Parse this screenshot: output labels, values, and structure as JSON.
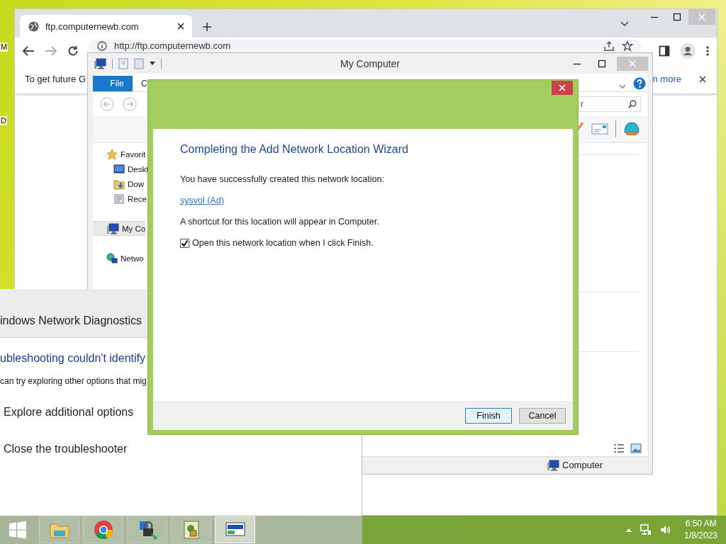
{
  "desktop": {
    "icon_labels": [
      "M",
      "D"
    ]
  },
  "browser": {
    "tab": {
      "title": "ftp.computernewb.com",
      "selected": true
    },
    "address": "http://ftp.computernewb.com",
    "infobar": {
      "message": "To get future G",
      "link": "n more"
    }
  },
  "explorer": {
    "title": "My Computer",
    "ribbon_tabs": [
      {
        "label": "File",
        "selected": true
      },
      {
        "label": "C",
        "selected": false
      }
    ],
    "search": {
      "placeholder": "r"
    },
    "nav_items": [
      {
        "label": "Favorit",
        "kind": "favorites",
        "selected": false,
        "children": [
          {
            "label": "Deskt",
            "kind": "desktop",
            "selected": false
          },
          {
            "label": "Dow",
            "kind": "downloads",
            "selected": false
          },
          {
            "label": "Rece",
            "kind": "recent",
            "selected": false
          }
        ]
      },
      {
        "label": "My Co",
        "kind": "computer",
        "selected": true
      },
      {
        "label": "Netwo",
        "kind": "network",
        "selected": false
      }
    ],
    "status_bar": {
      "item": "Computer"
    }
  },
  "troubleshooter": {
    "title": "indows Network Diagnostics",
    "heading": "ubleshooting couldn't identify",
    "description": "can try exploring other options that mig",
    "options": [
      "Explore additional options",
      "Close the troubleshooter"
    ]
  },
  "wizard": {
    "heading": "Completing the Add Network Location Wizard",
    "message": "You have successfully created this network location:",
    "location_link": "sysvol (Ad)",
    "note": "A shortcut for this location will appear in Computer.",
    "checkbox": {
      "label": "Open this network location when I click Finish.",
      "checked": true
    },
    "buttons": [
      {
        "label": "Finish",
        "default": true
      },
      {
        "label": "Cancel",
        "default": false
      }
    ]
  },
  "taskbar": {
    "apps": [
      {
        "kind": "explorer",
        "active": false
      },
      {
        "kind": "chrome",
        "active": false
      },
      {
        "kind": "lock",
        "active": false
      },
      {
        "kind": "tool",
        "active": false
      },
      {
        "kind": "computer",
        "active": true
      }
    ],
    "time": "6:50 AM",
    "date": "1/8/2023"
  }
}
